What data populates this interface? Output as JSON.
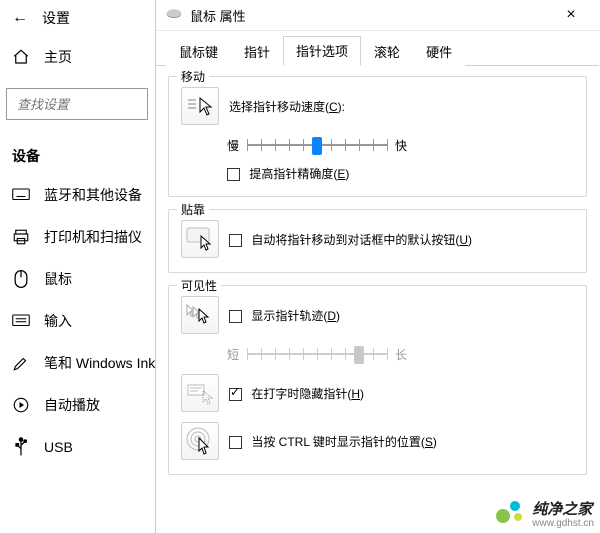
{
  "settings": {
    "title": "设置",
    "home": "主页",
    "search_placeholder": "查找设置",
    "section": "设备",
    "items": [
      {
        "label": "蓝牙和其他设备"
      },
      {
        "label": "打印机和扫描仪"
      },
      {
        "label": "鼠标"
      },
      {
        "label": "输入"
      },
      {
        "label": "笔和 Windows Ink"
      },
      {
        "label": "自动播放"
      },
      {
        "label": "USB"
      }
    ]
  },
  "dialog": {
    "title": "鼠标 属性",
    "tabs": [
      "鼠标键",
      "指针",
      "指针选项",
      "滚轮",
      "硬件"
    ],
    "active_tab": "指针选项",
    "groups": {
      "motion": {
        "title": "移动",
        "speed_label": "选择指针移动速度(C):",
        "slow": "慢",
        "fast": "快",
        "enhance": "提高指针精确度(E)",
        "enhance_checked": false,
        "speed_value": 6,
        "speed_max": 11
      },
      "snap": {
        "title": "贴靠",
        "snap_label": "自动将指针移动到对话框中的默认按钮(U)",
        "snap_checked": false
      },
      "visibility": {
        "title": "可见性",
        "trail": "显示指针轨迹(D)",
        "trail_checked": false,
        "short": "短",
        "long": "长",
        "trail_value": 9,
        "trail_max": 11,
        "hide_typing": "在打字时隐藏指针(H)",
        "hide_typing_checked": true,
        "ctrl_locate": "当按 CTRL 键时显示指针的位置(S)",
        "ctrl_locate_checked": false
      }
    }
  },
  "watermark": {
    "brand": "纯净之家",
    "url": "www.gdhst.cn"
  }
}
